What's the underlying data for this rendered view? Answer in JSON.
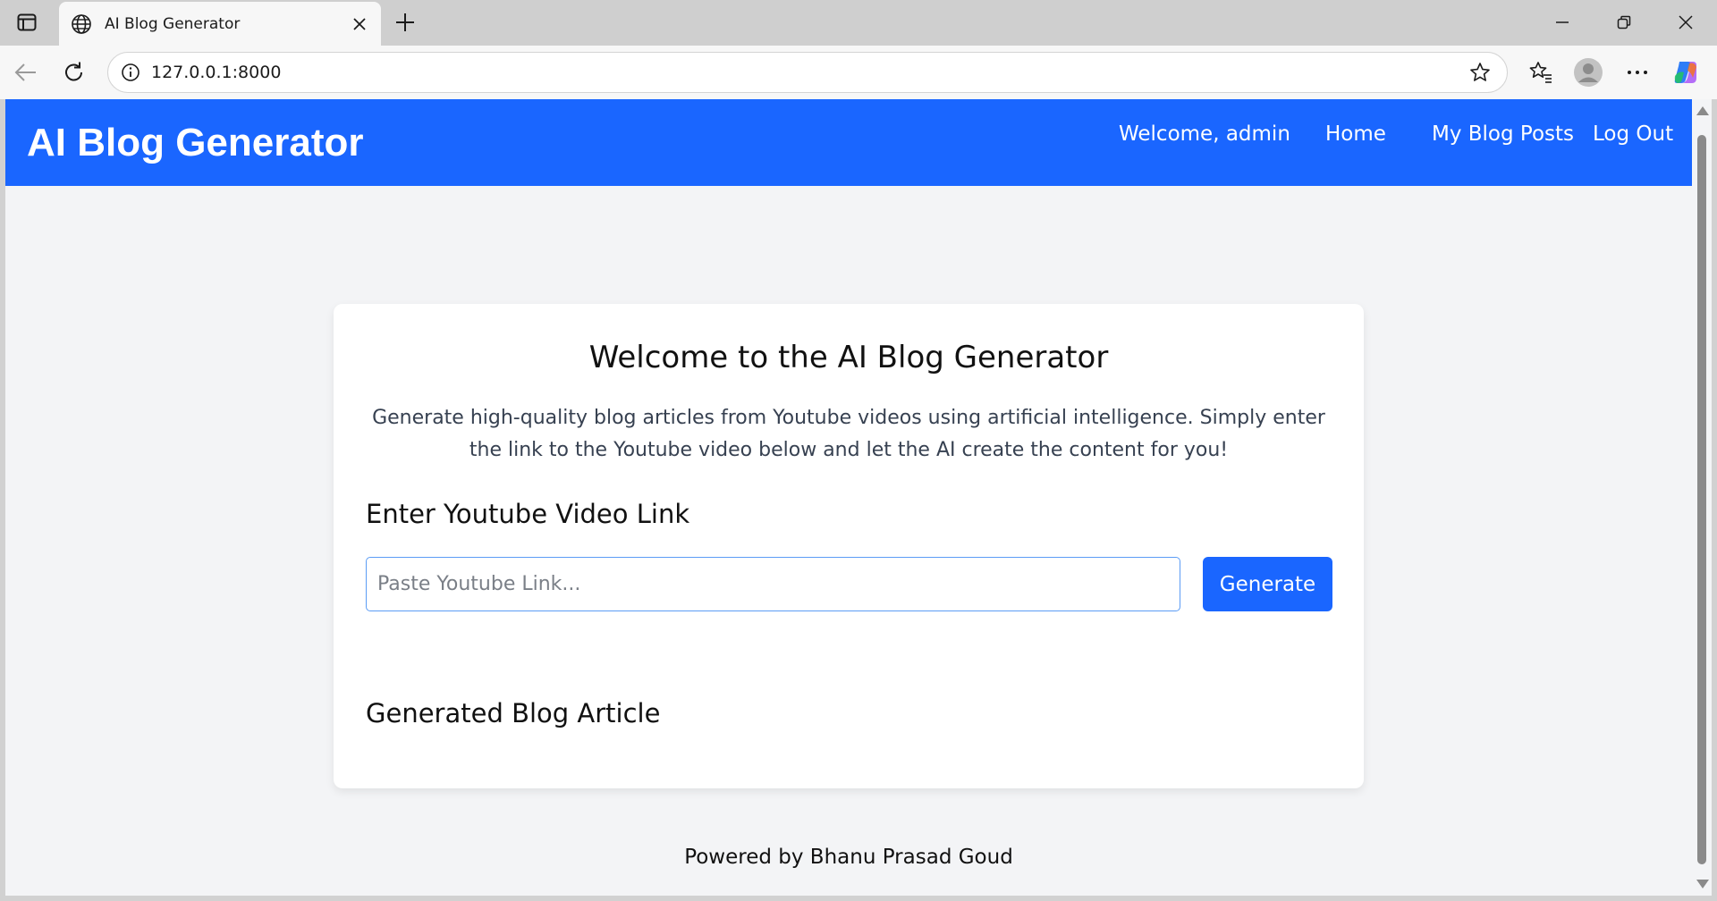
{
  "browser": {
    "tab_title": "AI Blog Generator",
    "url": "127.0.0.1:8000",
    "new_tab_label": "+"
  },
  "site": {
    "logo": "AI Blog Generator",
    "nav": {
      "welcome": "Welcome, admin",
      "home": "Home",
      "my_posts": "My Blog Posts",
      "logout": "Log Out"
    },
    "accent_color": "#1a66ff"
  },
  "main": {
    "title": "Welcome to the AI Blog Generator",
    "description": "Generate high-quality blog articles from Youtube videos using artificial intelligence. Simply enter the link to the Youtube video below and let the AI create the content for you!",
    "input_section_title": "Enter Youtube Video Link",
    "input": {
      "placeholder": "Paste Youtube Link...",
      "value": ""
    },
    "generate_button": "Generate",
    "output_section_title": "Generated Blog Article"
  },
  "footer": {
    "text": "Powered by Bhanu Prasad Goud"
  }
}
